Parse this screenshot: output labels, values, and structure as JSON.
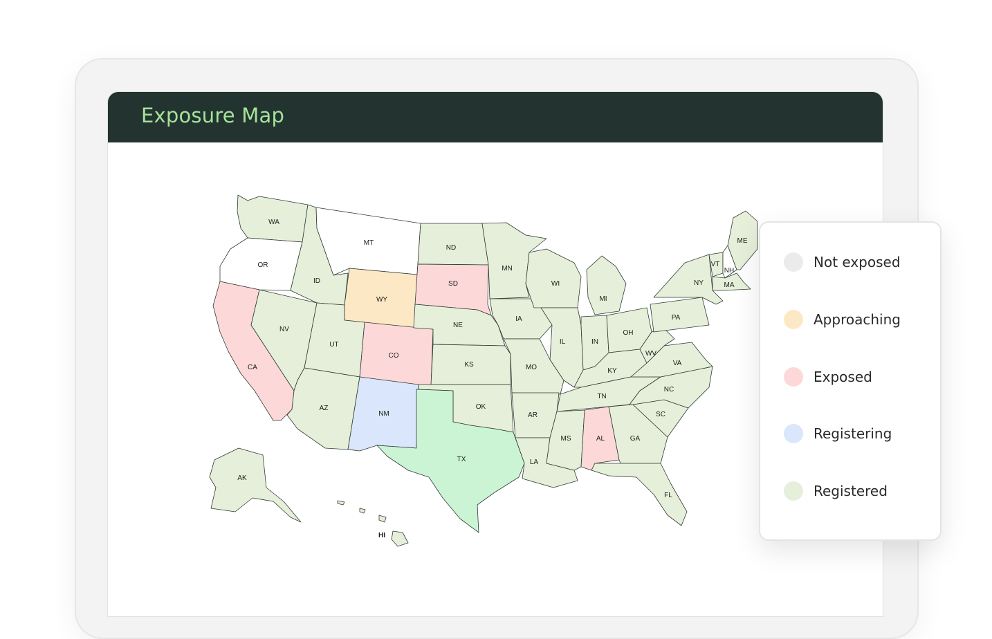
{
  "header": {
    "title": "Exposure Map"
  },
  "colors": {
    "not_exposed": "#ffffff",
    "approaching": "#fde8c6",
    "exposed": "#fdd8d9",
    "registering": "#d9e6fb",
    "registered": "#e5efd9",
    "texas": "#cbf4d5",
    "header_bg": "#223330",
    "header_text": "#a6e39a"
  },
  "legend": {
    "items": [
      {
        "label": "Not exposed",
        "color": "#ebebeb"
      },
      {
        "label": "Approaching",
        "color": "#fde8c6"
      },
      {
        "label": "Exposed",
        "color": "#fdd8d9"
      },
      {
        "label": "Registering",
        "color": "#d9e6fb"
      },
      {
        "label": "Registered",
        "color": "#e5efd9"
      }
    ]
  },
  "states": [
    {
      "code": "WA",
      "status": "registered"
    },
    {
      "code": "OR",
      "status": "not_exposed"
    },
    {
      "code": "CA",
      "status": "exposed"
    },
    {
      "code": "NV",
      "status": "registered"
    },
    {
      "code": "ID",
      "status": "registered"
    },
    {
      "code": "MT",
      "status": "not_exposed"
    },
    {
      "code": "WY",
      "status": "approaching"
    },
    {
      "code": "UT",
      "status": "registered"
    },
    {
      "code": "CO",
      "status": "exposed"
    },
    {
      "code": "AZ",
      "status": "registered"
    },
    {
      "code": "NM",
      "status": "registering"
    },
    {
      "code": "ND",
      "status": "registered"
    },
    {
      "code": "SD",
      "status": "exposed"
    },
    {
      "code": "NE",
      "status": "registered"
    },
    {
      "code": "KS",
      "status": "registered"
    },
    {
      "code": "OK",
      "status": "registered"
    },
    {
      "code": "TX",
      "status": "texas"
    },
    {
      "code": "MN",
      "status": "registered"
    },
    {
      "code": "IA",
      "status": "registered"
    },
    {
      "code": "MO",
      "status": "registered"
    },
    {
      "code": "AR",
      "status": "registered"
    },
    {
      "code": "LA",
      "status": "registered"
    },
    {
      "code": "WI",
      "status": "registered"
    },
    {
      "code": "IL",
      "status": "registered"
    },
    {
      "code": "MI",
      "status": "registered"
    },
    {
      "code": "IN",
      "status": "registered"
    },
    {
      "code": "OH",
      "status": "registered"
    },
    {
      "code": "KY",
      "status": "registered"
    },
    {
      "code": "TN",
      "status": "registered"
    },
    {
      "code": "MS",
      "status": "registered"
    },
    {
      "code": "AL",
      "status": "exposed"
    },
    {
      "code": "GA",
      "status": "registered"
    },
    {
      "code": "FL",
      "status": "registered"
    },
    {
      "code": "SC",
      "status": "registered"
    },
    {
      "code": "NC",
      "status": "registered"
    },
    {
      "code": "VA",
      "status": "registered"
    },
    {
      "code": "WV",
      "status": "registered"
    },
    {
      "code": "PA",
      "status": "registered"
    },
    {
      "code": "NY",
      "status": "registered"
    },
    {
      "code": "VT",
      "status": "registered"
    },
    {
      "code": "NH",
      "status": "not_exposed"
    },
    {
      "code": "ME",
      "status": "registered"
    },
    {
      "code": "MA",
      "status": "registered"
    },
    {
      "code": "AK",
      "status": "registered"
    },
    {
      "code": "HI",
      "status": "registered"
    }
  ]
}
